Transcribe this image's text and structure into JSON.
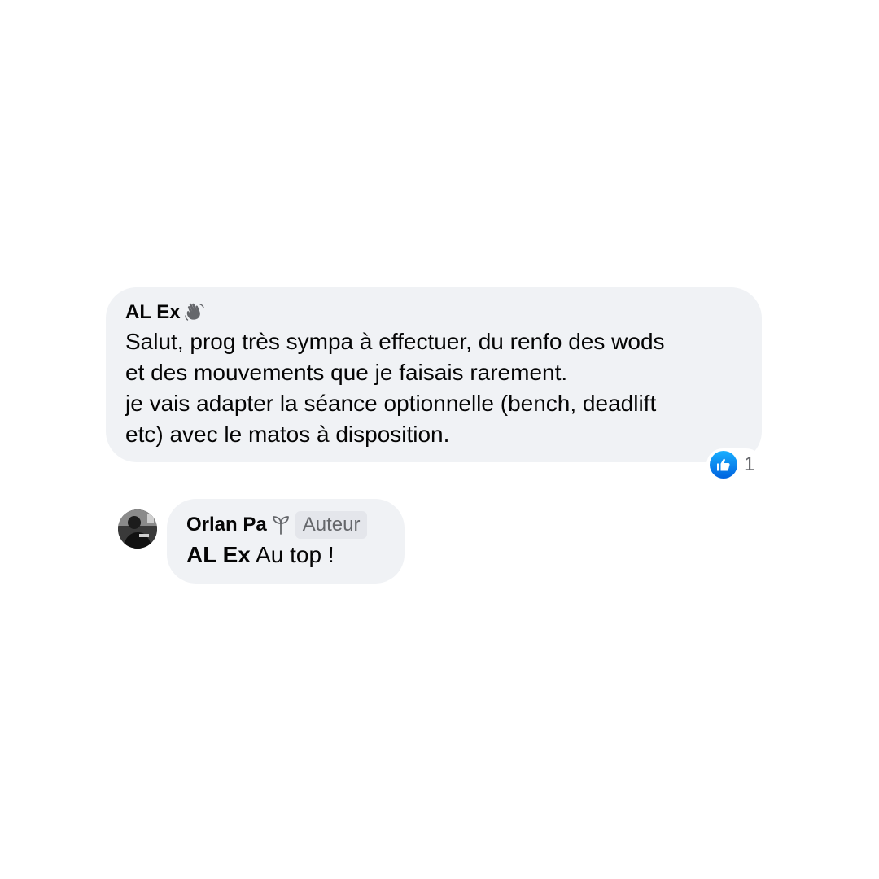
{
  "comment": {
    "author": "AL Ex",
    "text_lines": [
      "Salut, prog très sympa à effectuer, du renfo des wods",
      "et des mouvements que je faisais rarement.",
      "je vais adapter la séance optionnelle (bench, deadlift",
      "etc) avec le matos à disposition."
    ],
    "reaction_icon": "like-icon",
    "reaction_count": "1",
    "author_badge_icon": "waving-hand-icon"
  },
  "reply": {
    "author": "Orlan Pa",
    "author_badge_icon": "sprout-icon",
    "role_badge": "Auteur",
    "mention": "AL Ex",
    "text": " Au top !"
  },
  "colors": {
    "bubble": "#f0f2f5",
    "like_blue": "#0866ff",
    "secondary_text": "#65676b"
  }
}
